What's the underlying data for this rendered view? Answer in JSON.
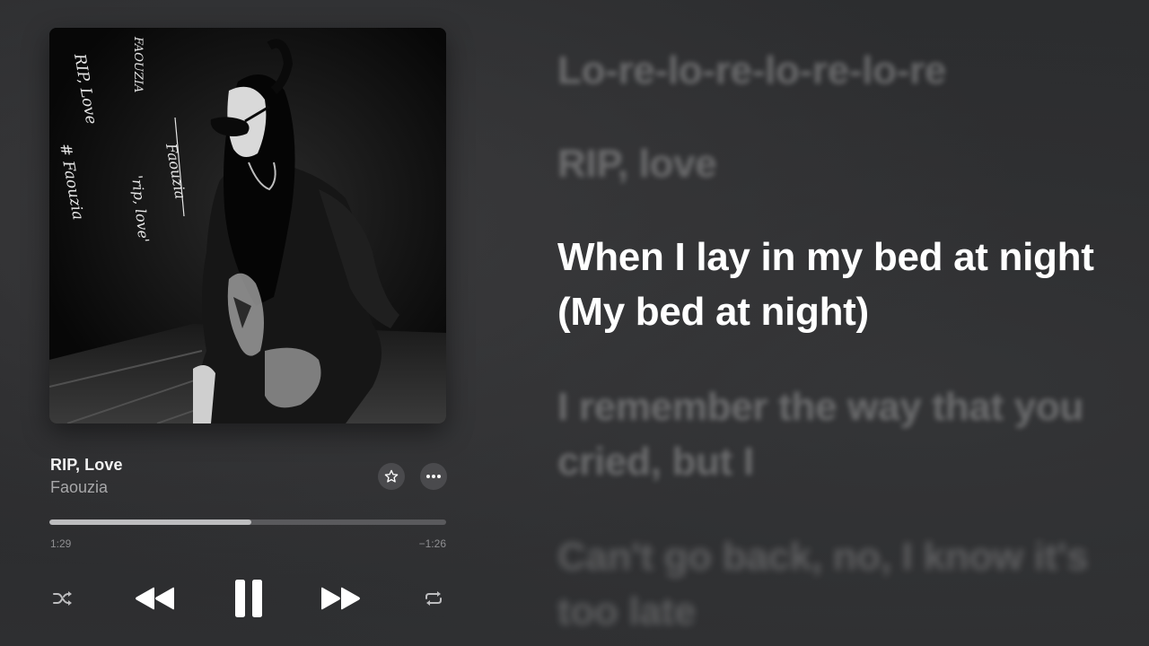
{
  "track": {
    "title": "RIP, Love",
    "artist": "Faouzia"
  },
  "artwork": {
    "handwriting": [
      "FAOUZIA",
      "RIP, Love",
      "# Faouzia",
      "Faouzia",
      "'rip, love'"
    ]
  },
  "progress": {
    "elapsed": "1:29",
    "remaining": "−1:26",
    "fraction": 0.51
  },
  "icons": {
    "favorite": "star-icon",
    "more": "ellipsis-icon",
    "shuffle": "shuffle-icon",
    "rewind": "rewind-icon",
    "pause": "pause-icon",
    "forward": "fast-forward-icon",
    "repeat": "repeat-icon"
  },
  "colors": {
    "background": "#2a2b2d",
    "active_lyric": "#ffffff",
    "progress_fill": "#bdbdbf",
    "progress_track": "#5a5a5d"
  },
  "lyrics": {
    "lines": [
      {
        "text": "Lo-re-lo-re-lo-re-lo-re",
        "state": "past"
      },
      {
        "text": "RIP, love",
        "state": "past"
      },
      {
        "text": "When I lay in my bed at night (My bed at night)",
        "state": "current"
      },
      {
        "text": "I remember the way that you cried, but I",
        "state": "upcoming"
      },
      {
        "text": "Can't go back, no, I know it's too late",
        "state": "upcoming"
      }
    ]
  }
}
